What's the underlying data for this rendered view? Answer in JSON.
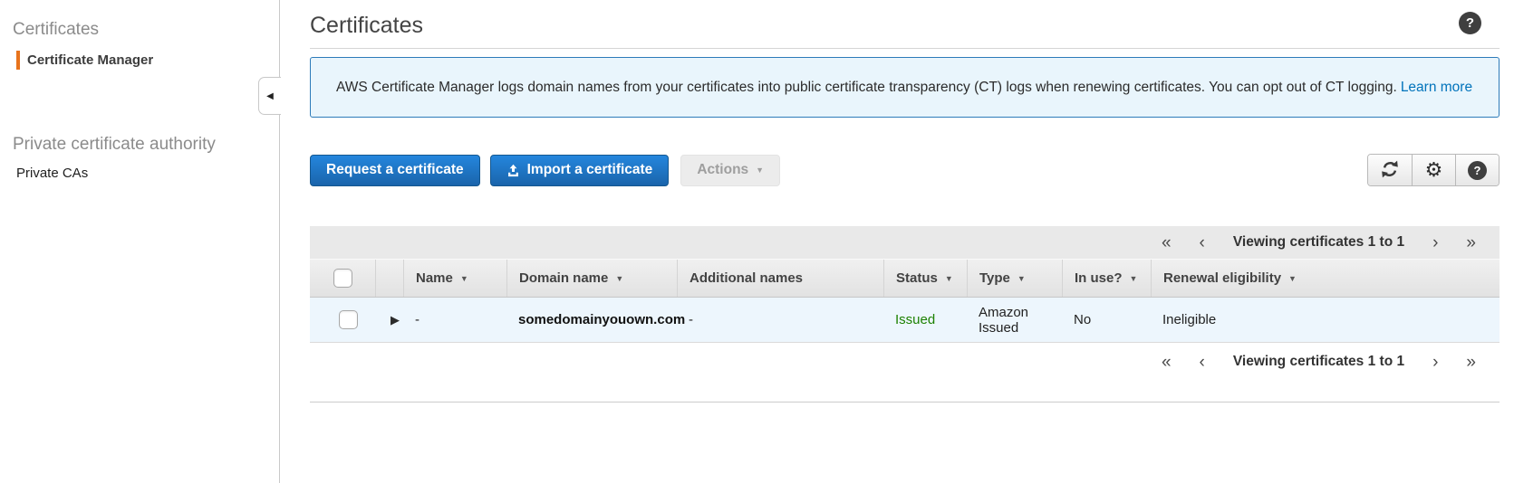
{
  "sidebar": {
    "certificates_heading": "Certificates",
    "certificate_manager_label": "Certificate Manager",
    "private_ca_heading": "Private certificate authority",
    "private_cas_label": "Private CAs"
  },
  "header": {
    "title": "Certificates"
  },
  "banner": {
    "text": "AWS Certificate Manager logs domain names from your certificates into public certificate transparency (CT) logs when renewing certificates. You can opt out of CT logging.",
    "link_label": "Learn more"
  },
  "toolbar": {
    "request_label": "Request a certificate",
    "import_label": "Import a certificate",
    "actions_label": "Actions"
  },
  "table": {
    "pagination_label": "Viewing certificates 1 to 1",
    "columns": [
      {
        "label": "Name",
        "sortable": true
      },
      {
        "label": "Domain name",
        "sortable": true
      },
      {
        "label": "Additional names",
        "sortable": false
      },
      {
        "label": "Status",
        "sortable": true
      },
      {
        "label": "Type",
        "sortable": true
      },
      {
        "label": "In use?",
        "sortable": true
      },
      {
        "label": "Renewal eligibility",
        "sortable": true
      }
    ],
    "row": {
      "name": "-",
      "domain_name": "somedomainyouown.com",
      "additional_names": "-",
      "status": "Issued",
      "type": "Amazon Issued",
      "in_use": "No",
      "renewal_eligibility": "Ineligible"
    }
  },
  "icons": {
    "help": "?",
    "gear": "⚙",
    "sort": "▼",
    "caret": "▼",
    "expand": "▶",
    "collapse": "◀",
    "first_page": "«",
    "prev_page": "‹",
    "next_page": "›",
    "last_page": "»"
  },
  "colors": {
    "primary_button_blue": "#1f6fc0",
    "link_blue": "#0073bb",
    "status_issued_green": "#1d8102",
    "active_nav_accent_orange": "#e8731c",
    "banner_border_blue": "#2d7bb9",
    "banner_bg_blue": "#e9f5fc",
    "selected_row_bg_blue": "#edf6fd"
  }
}
